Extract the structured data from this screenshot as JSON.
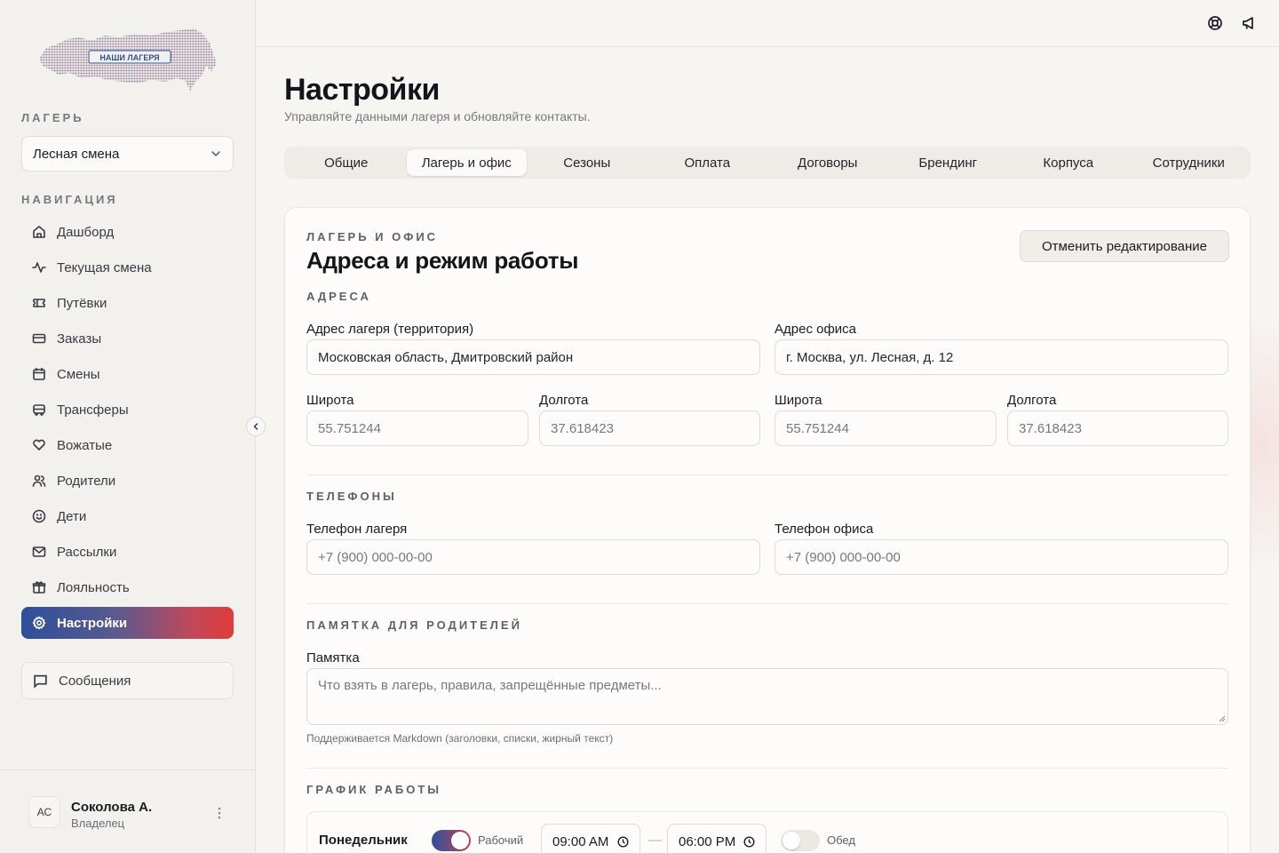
{
  "brand": {
    "logo_text": "НАШИ ЛАГЕРЯ"
  },
  "sidebar": {
    "camp_section": "ЛАГЕРЬ",
    "camp_selected": "Лесная смена",
    "nav_section": "НАВИГАЦИЯ",
    "items": [
      {
        "label": "Дашборд",
        "icon": "home-icon"
      },
      {
        "label": "Текущая смена",
        "icon": "activity-icon"
      },
      {
        "label": "Путёвки",
        "icon": "ticket-icon"
      },
      {
        "label": "Заказы",
        "icon": "card-icon"
      },
      {
        "label": "Смены",
        "icon": "calendar-icon"
      },
      {
        "label": "Трансферы",
        "icon": "bus-icon"
      },
      {
        "label": "Вожатые",
        "icon": "heart-hand-icon"
      },
      {
        "label": "Родители",
        "icon": "users-icon"
      },
      {
        "label": "Дети",
        "icon": "smile-icon"
      },
      {
        "label": "Рассылки",
        "icon": "mail-icon"
      },
      {
        "label": "Лояльность",
        "icon": "gift-icon"
      },
      {
        "label": "Настройки",
        "icon": "gear-icon",
        "active": true
      }
    ],
    "messages_label": "Сообщения",
    "user": {
      "initials": "АС",
      "name": "Соколова А.",
      "role": "Владелец"
    }
  },
  "header": {
    "title": "Настройки",
    "subtitle": "Управляйте данными лагеря и обновляйте контакты.",
    "tabs": [
      "Общие",
      "Лагерь и офис",
      "Сезоны",
      "Оплата",
      "Договоры",
      "Брендинг",
      "Корпуса",
      "Сотрудники"
    ],
    "active_tab": "Лагерь и офис"
  },
  "card": {
    "eyebrow": "ЛАГЕРЬ И ОФИС",
    "title": "Адреса и режим работы",
    "cancel_label": "Отменить редактирование",
    "addresses": {
      "section": "АДРЕСА",
      "camp_address_label": "Адрес лагеря (территория)",
      "camp_address_value": "Московская область, Дмитровский район",
      "office_address_label": "Адрес офиса",
      "office_address_value": "г. Москва, ул. Лесная, д. 12",
      "lat_label": "Широта",
      "lon_label": "Долгота",
      "camp_lat_placeholder": "55.751244",
      "camp_lon_placeholder": "37.618423",
      "office_lat_placeholder": "55.751244",
      "office_lon_placeholder": "37.618423"
    },
    "phones": {
      "section": "ТЕЛЕФОНЫ",
      "camp_phone_label": "Телефон лагеря",
      "office_phone_label": "Телефон офиса",
      "camp_phone_placeholder": "+7 (900) 000-00-00",
      "office_phone_placeholder": "+7 (900) 000-00-00"
    },
    "memo": {
      "section": "ПАМЯТКА ДЛЯ РОДИТЕЛЕЙ",
      "label": "Памятка",
      "placeholder": "Что взять в лагерь, правила, запрещённые предметы...",
      "hint": "Поддерживается Markdown (заголовки, списки, жирный текст)"
    },
    "schedule": {
      "section": "ГРАФИК РАБОТЫ",
      "rows": [
        {
          "day": "Понедельник",
          "working_label": "Рабочий",
          "working": true,
          "from": "09:00 AM",
          "dash": "—",
          "to": "06:00 PM",
          "lunch_label": "Обед",
          "lunch": false
        }
      ]
    }
  },
  "colors": {
    "accent_blue": "#2e4f9a",
    "accent_red": "#e03c3a"
  }
}
